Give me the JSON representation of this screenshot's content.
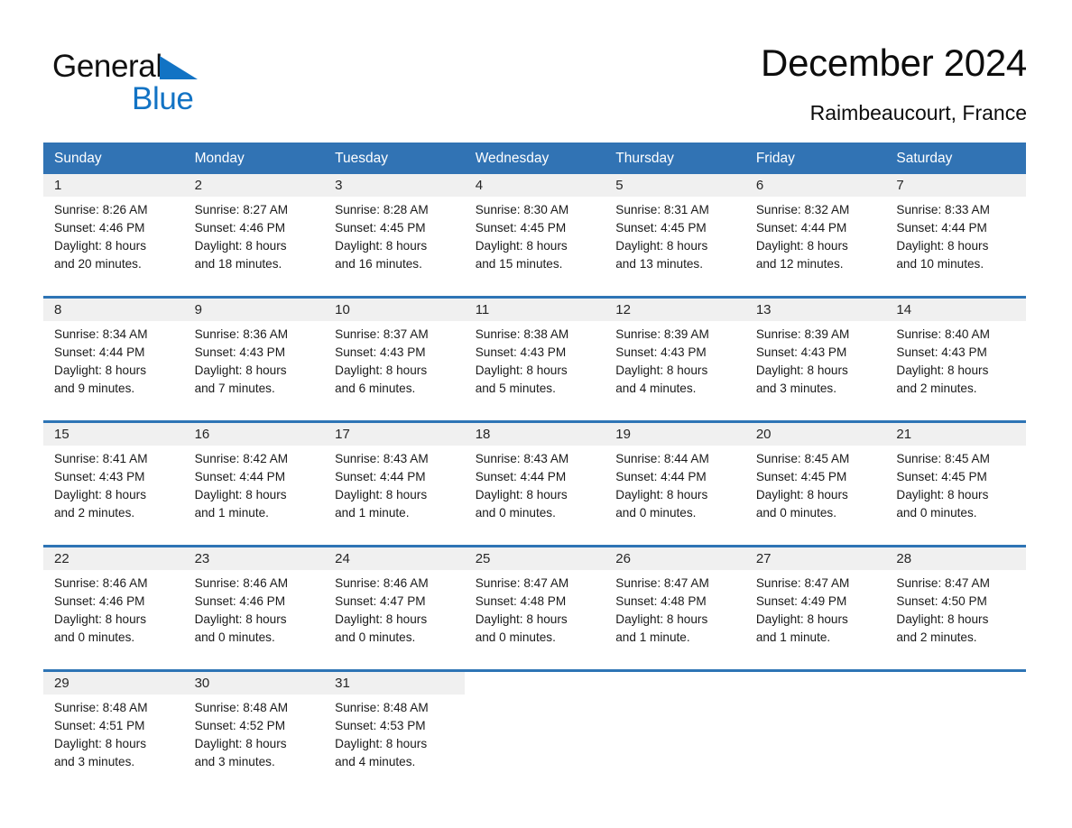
{
  "brand": {
    "name_part1": "General",
    "name_part2": "Blue",
    "triangle_color": "#1273c4"
  },
  "header": {
    "title": "December 2024",
    "subtitle": "Raimbeaucourt, France"
  },
  "colors": {
    "header_blue": "#3173b4",
    "row_rule_blue": "#2e74b5",
    "daynum_strip": "#f0f0f0",
    "background": "#ffffff",
    "text": "#1a1a1a"
  },
  "weekday_headers": [
    "Sunday",
    "Monday",
    "Tuesday",
    "Wednesday",
    "Thursday",
    "Friday",
    "Saturday"
  ],
  "weeks": [
    {
      "days": [
        {
          "num": "1",
          "lines": [
            "Sunrise: 8:26 AM",
            "Sunset: 4:46 PM",
            "Daylight: 8 hours",
            "and 20 minutes."
          ]
        },
        {
          "num": "2",
          "lines": [
            "Sunrise: 8:27 AM",
            "Sunset: 4:46 PM",
            "Daylight: 8 hours",
            "and 18 minutes."
          ]
        },
        {
          "num": "3",
          "lines": [
            "Sunrise: 8:28 AM",
            "Sunset: 4:45 PM",
            "Daylight: 8 hours",
            "and 16 minutes."
          ]
        },
        {
          "num": "4",
          "lines": [
            "Sunrise: 8:30 AM",
            "Sunset: 4:45 PM",
            "Daylight: 8 hours",
            "and 15 minutes."
          ]
        },
        {
          "num": "5",
          "lines": [
            "Sunrise: 8:31 AM",
            "Sunset: 4:45 PM",
            "Daylight: 8 hours",
            "and 13 minutes."
          ]
        },
        {
          "num": "6",
          "lines": [
            "Sunrise: 8:32 AM",
            "Sunset: 4:44 PM",
            "Daylight: 8 hours",
            "and 12 minutes."
          ]
        },
        {
          "num": "7",
          "lines": [
            "Sunrise: 8:33 AM",
            "Sunset: 4:44 PM",
            "Daylight: 8 hours",
            "and 10 minutes."
          ]
        }
      ]
    },
    {
      "days": [
        {
          "num": "8",
          "lines": [
            "Sunrise: 8:34 AM",
            "Sunset: 4:44 PM",
            "Daylight: 8 hours",
            "and 9 minutes."
          ]
        },
        {
          "num": "9",
          "lines": [
            "Sunrise: 8:36 AM",
            "Sunset: 4:43 PM",
            "Daylight: 8 hours",
            "and 7 minutes."
          ]
        },
        {
          "num": "10",
          "lines": [
            "Sunrise: 8:37 AM",
            "Sunset: 4:43 PM",
            "Daylight: 8 hours",
            "and 6 minutes."
          ]
        },
        {
          "num": "11",
          "lines": [
            "Sunrise: 8:38 AM",
            "Sunset: 4:43 PM",
            "Daylight: 8 hours",
            "and 5 minutes."
          ]
        },
        {
          "num": "12",
          "lines": [
            "Sunrise: 8:39 AM",
            "Sunset: 4:43 PM",
            "Daylight: 8 hours",
            "and 4 minutes."
          ]
        },
        {
          "num": "13",
          "lines": [
            "Sunrise: 8:39 AM",
            "Sunset: 4:43 PM",
            "Daylight: 8 hours",
            "and 3 minutes."
          ]
        },
        {
          "num": "14",
          "lines": [
            "Sunrise: 8:40 AM",
            "Sunset: 4:43 PM",
            "Daylight: 8 hours",
            "and 2 minutes."
          ]
        }
      ]
    },
    {
      "days": [
        {
          "num": "15",
          "lines": [
            "Sunrise: 8:41 AM",
            "Sunset: 4:43 PM",
            "Daylight: 8 hours",
            "and 2 minutes."
          ]
        },
        {
          "num": "16",
          "lines": [
            "Sunrise: 8:42 AM",
            "Sunset: 4:44 PM",
            "Daylight: 8 hours",
            "and 1 minute."
          ]
        },
        {
          "num": "17",
          "lines": [
            "Sunrise: 8:43 AM",
            "Sunset: 4:44 PM",
            "Daylight: 8 hours",
            "and 1 minute."
          ]
        },
        {
          "num": "18",
          "lines": [
            "Sunrise: 8:43 AM",
            "Sunset: 4:44 PM",
            "Daylight: 8 hours",
            "and 0 minutes."
          ]
        },
        {
          "num": "19",
          "lines": [
            "Sunrise: 8:44 AM",
            "Sunset: 4:44 PM",
            "Daylight: 8 hours",
            "and 0 minutes."
          ]
        },
        {
          "num": "20",
          "lines": [
            "Sunrise: 8:45 AM",
            "Sunset: 4:45 PM",
            "Daylight: 8 hours",
            "and 0 minutes."
          ]
        },
        {
          "num": "21",
          "lines": [
            "Sunrise: 8:45 AM",
            "Sunset: 4:45 PM",
            "Daylight: 8 hours",
            "and 0 minutes."
          ]
        }
      ]
    },
    {
      "days": [
        {
          "num": "22",
          "lines": [
            "Sunrise: 8:46 AM",
            "Sunset: 4:46 PM",
            "Daylight: 8 hours",
            "and 0 minutes."
          ]
        },
        {
          "num": "23",
          "lines": [
            "Sunrise: 8:46 AM",
            "Sunset: 4:46 PM",
            "Daylight: 8 hours",
            "and 0 minutes."
          ]
        },
        {
          "num": "24",
          "lines": [
            "Sunrise: 8:46 AM",
            "Sunset: 4:47 PM",
            "Daylight: 8 hours",
            "and 0 minutes."
          ]
        },
        {
          "num": "25",
          "lines": [
            "Sunrise: 8:47 AM",
            "Sunset: 4:48 PM",
            "Daylight: 8 hours",
            "and 0 minutes."
          ]
        },
        {
          "num": "26",
          "lines": [
            "Sunrise: 8:47 AM",
            "Sunset: 4:48 PM",
            "Daylight: 8 hours",
            "and 1 minute."
          ]
        },
        {
          "num": "27",
          "lines": [
            "Sunrise: 8:47 AM",
            "Sunset: 4:49 PM",
            "Daylight: 8 hours",
            "and 1 minute."
          ]
        },
        {
          "num": "28",
          "lines": [
            "Sunrise: 8:47 AM",
            "Sunset: 4:50 PM",
            "Daylight: 8 hours",
            "and 2 minutes."
          ]
        }
      ]
    },
    {
      "days": [
        {
          "num": "29",
          "lines": [
            "Sunrise: 8:48 AM",
            "Sunset: 4:51 PM",
            "Daylight: 8 hours",
            "and 3 minutes."
          ]
        },
        {
          "num": "30",
          "lines": [
            "Sunrise: 8:48 AM",
            "Sunset: 4:52 PM",
            "Daylight: 8 hours",
            "and 3 minutes."
          ]
        },
        {
          "num": "31",
          "lines": [
            "Sunrise: 8:48 AM",
            "Sunset: 4:53 PM",
            "Daylight: 8 hours",
            "and 4 minutes."
          ]
        },
        {
          "num": "",
          "lines": []
        },
        {
          "num": "",
          "lines": []
        },
        {
          "num": "",
          "lines": []
        },
        {
          "num": "",
          "lines": []
        }
      ]
    }
  ]
}
